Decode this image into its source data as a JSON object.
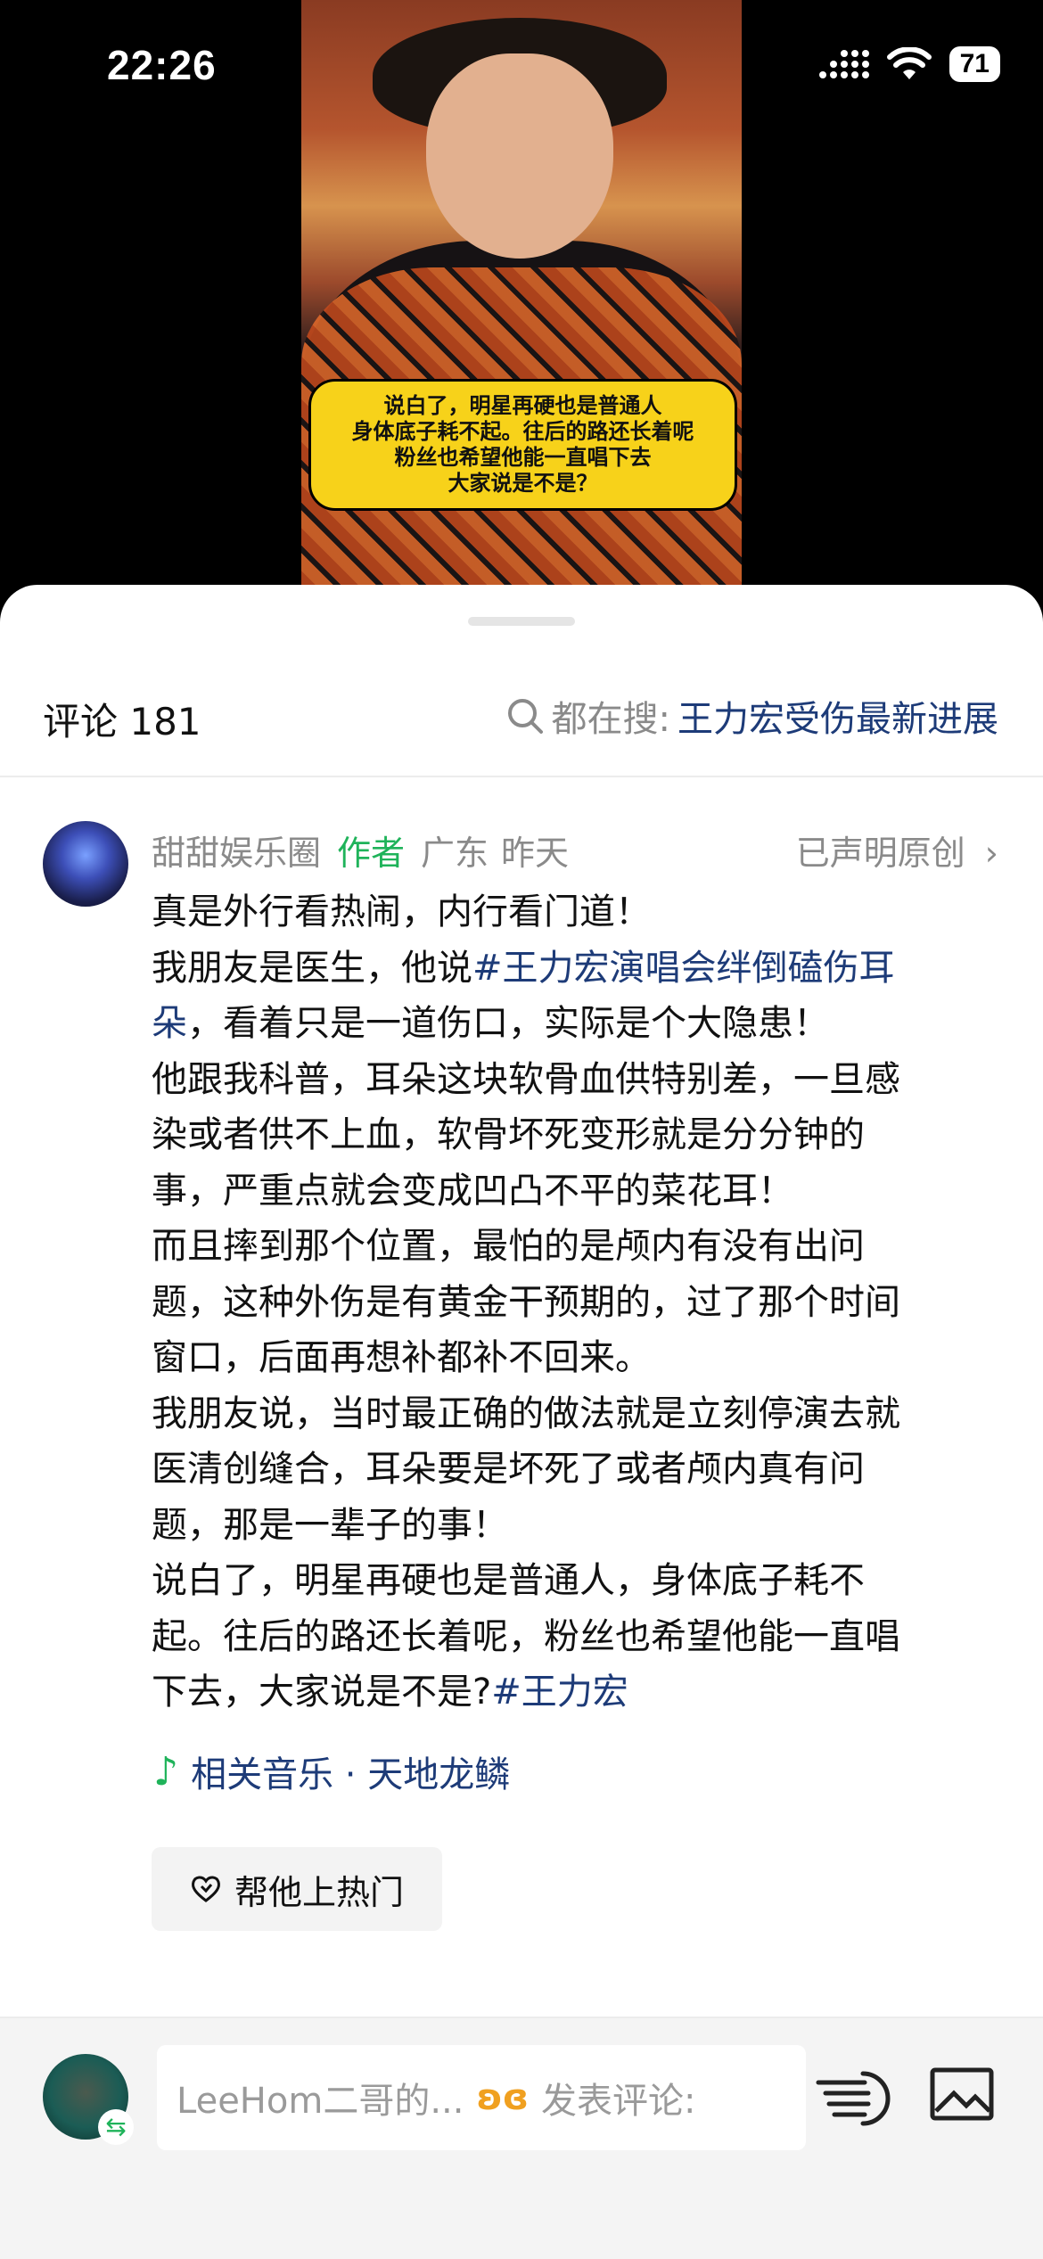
{
  "status_bar": {
    "time": "22:26",
    "battery": "71"
  },
  "video": {
    "caption_lines": [
      "说白了，明星再硬也是普通人",
      "身体底子耗不起。往后的路还长着呢",
      "粉丝也希望他能一直唱下去",
      "大家说是不是？"
    ]
  },
  "comments_header": {
    "count_label": "评论 181",
    "search_prefix": "都在搜:",
    "search_term": "王力宏受伤最新进展"
  },
  "post": {
    "author": "甜甜娱乐圈",
    "author_badge": "作者",
    "location": "广东",
    "time": "昨天",
    "original_label": "已声明原创",
    "lines": [
      [
        {
          "t": "真是外行看热闹，内行看门道！"
        }
      ],
      [
        {
          "t": "我朋友是医生，他说"
        },
        {
          "t": "#王力宏演唱会绊倒磕伤耳",
          "tag": true
        }
      ],
      [
        {
          "t": "朵",
          "tag": true
        },
        {
          "t": "，看着只是一道伤口，实际是个大隐患！"
        }
      ],
      [
        {
          "t": "他跟我科普，耳朵这块软骨血供特别差，一旦感"
        }
      ],
      [
        {
          "t": "染或者供不上血，软骨坏死变形就是分分钟的"
        }
      ],
      [
        {
          "t": "事，严重点就会变成凹凸不平的菜花耳！"
        }
      ],
      [
        {
          "t": "而且摔到那个位置，最怕的是颅内有没有出问"
        }
      ],
      [
        {
          "t": "题，这种外伤是有黄金干预期的，过了那个时间"
        }
      ],
      [
        {
          "t": "窗口，后面再想补都补不回来。"
        }
      ],
      [
        {
          "t": "我朋友说，当时最正确的做法就是立刻停演去就"
        }
      ],
      [
        {
          "t": "医清创缝合，耳朵要是坏死了或者颅内真有问"
        }
      ],
      [
        {
          "t": "题，那是一辈子的事！"
        }
      ],
      [
        {
          "t": "说白了，明星再硬也是普通人，身体底子耗不"
        }
      ],
      [
        {
          "t": "起。往后的路还长着呢，粉丝也希望他能一直唱"
        }
      ],
      [
        {
          "t": "下去，大家说是不是?"
        },
        {
          "t": "#王力宏",
          "tag": true
        }
      ]
    ],
    "music_label": "相关音乐 · 天地龙鳞",
    "hot_button": "帮他上热门"
  },
  "composer": {
    "placeholder_user": "LeeHom二哥的...",
    "placeholder_action": "发表评论:"
  },
  "icons": [
    "search-icon",
    "chevron-right-icon",
    "music-note-icon",
    "heart-icon",
    "voice-icon",
    "image-icon",
    "swap-icon",
    "signal-icon",
    "wifi-icon"
  ],
  "colors": {
    "author_green": "#1fb35a",
    "link_blue": "#1d3b78",
    "caption_yellow": "#f7d21a"
  }
}
